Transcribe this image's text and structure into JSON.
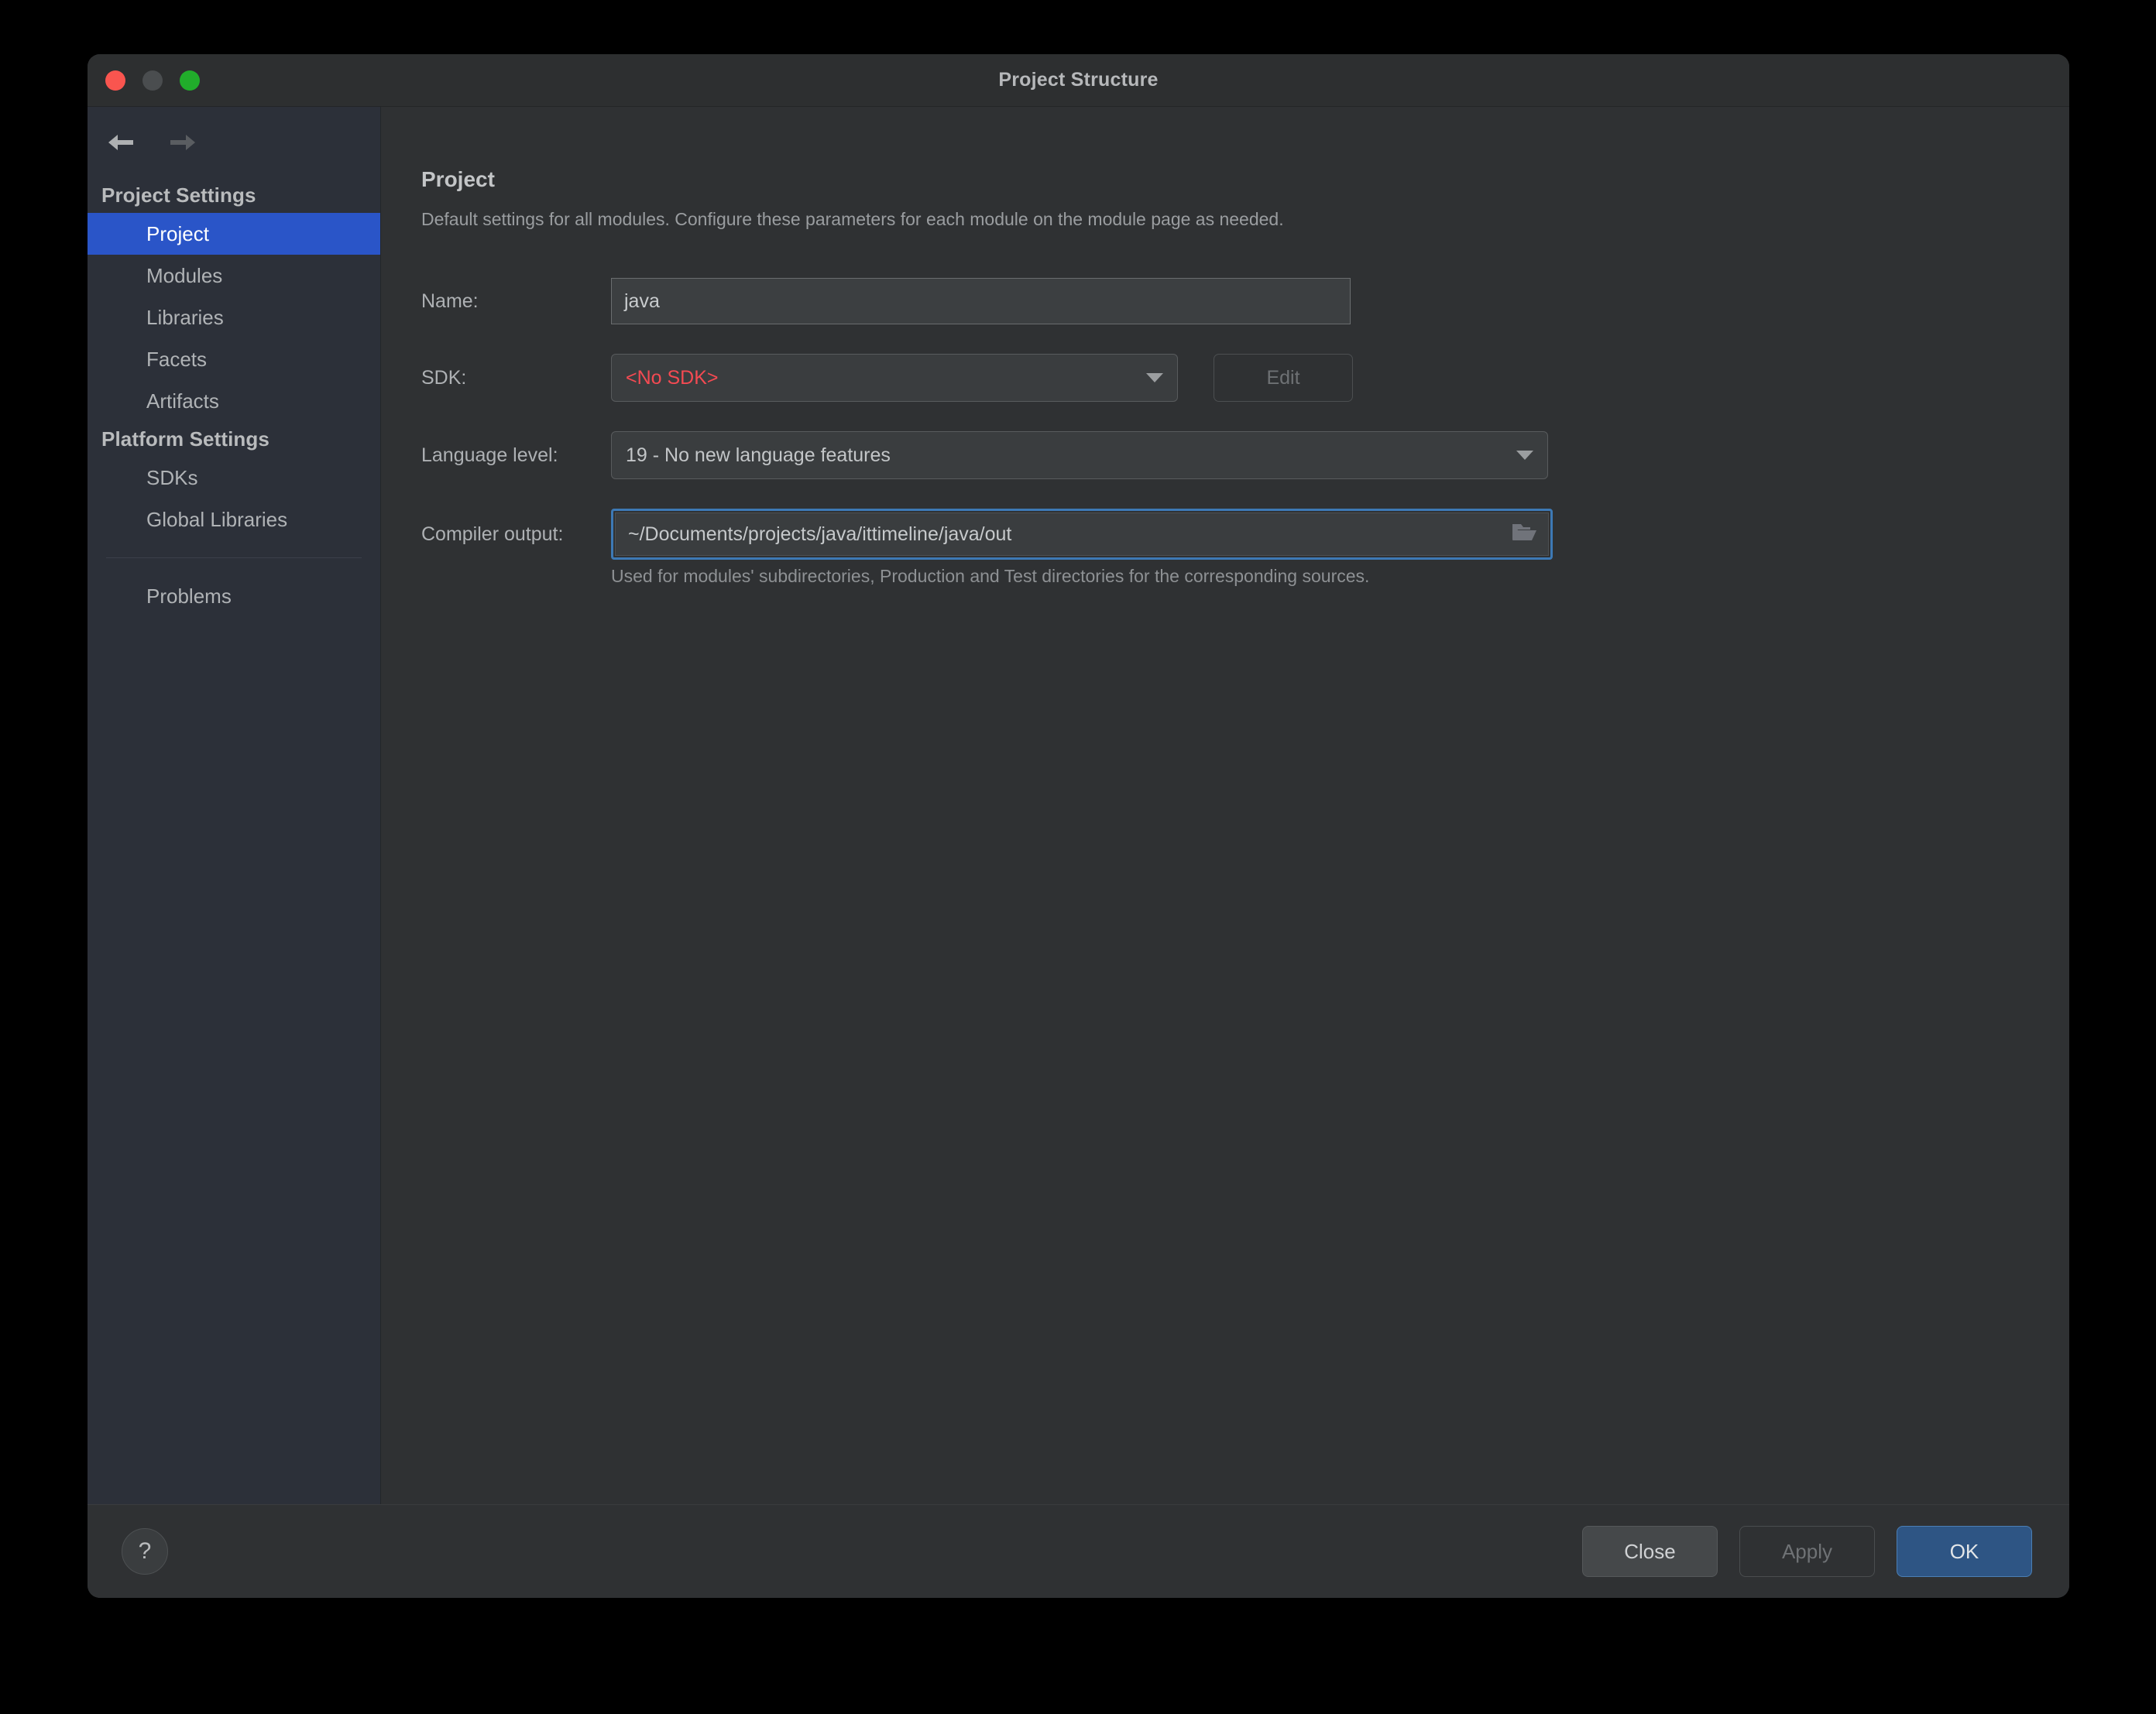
{
  "window": {
    "title": "Project Structure",
    "traffic_lights": [
      "close-red",
      "minimize-gray",
      "zoom-green"
    ]
  },
  "nav": {
    "back_icon": "arrow-left-icon",
    "forward_icon": "arrow-right-icon"
  },
  "sidebar": {
    "groups": [
      {
        "title": "Project Settings",
        "items": [
          {
            "label": "Project",
            "selected": true
          },
          {
            "label": "Modules",
            "selected": false
          },
          {
            "label": "Libraries",
            "selected": false
          },
          {
            "label": "Facets",
            "selected": false
          },
          {
            "label": "Artifacts",
            "selected": false
          }
        ]
      },
      {
        "title": "Platform Settings",
        "items": [
          {
            "label": "SDKs",
            "selected": false
          },
          {
            "label": "Global Libraries",
            "selected": false
          }
        ]
      }
    ],
    "extra_items": [
      {
        "label": "Problems",
        "selected": false
      }
    ]
  },
  "main": {
    "title": "Project",
    "description": "Default settings for all modules. Configure these parameters for each module on the module page as needed.",
    "fields": {
      "name": {
        "label": "Name:",
        "value": "java"
      },
      "sdk": {
        "label": "SDK:",
        "value": "<No SDK>",
        "value_color": "#f44a52",
        "edit_button": "Edit",
        "edit_enabled": false,
        "caret_icon": "chevron-down-icon"
      },
      "language_level": {
        "label": "Language level:",
        "value": "19 - No new language features",
        "caret_icon": "chevron-down-icon"
      },
      "compiler_output": {
        "label": "Compiler output:",
        "value": "~/Documents/projects/java/ittimeline/java/out",
        "browse_icon": "folder-icon",
        "focused": true,
        "hint": "Used for modules' subdirectories, Production and Test directories for the corresponding sources."
      }
    }
  },
  "footer": {
    "help_label": "?",
    "close_label": "Close",
    "apply_label": "Apply",
    "apply_enabled": false,
    "ok_label": "OK"
  },
  "colors": {
    "accent_selection": "#2a55c8",
    "accent_primary_button": "#2e5584",
    "error_text": "#f44a52",
    "focus_ring": "#3d79b5",
    "window_bg": "#2f3133",
    "sidebar_bg": "#2c3039",
    "titlebar_bg": "#2d2f30"
  }
}
